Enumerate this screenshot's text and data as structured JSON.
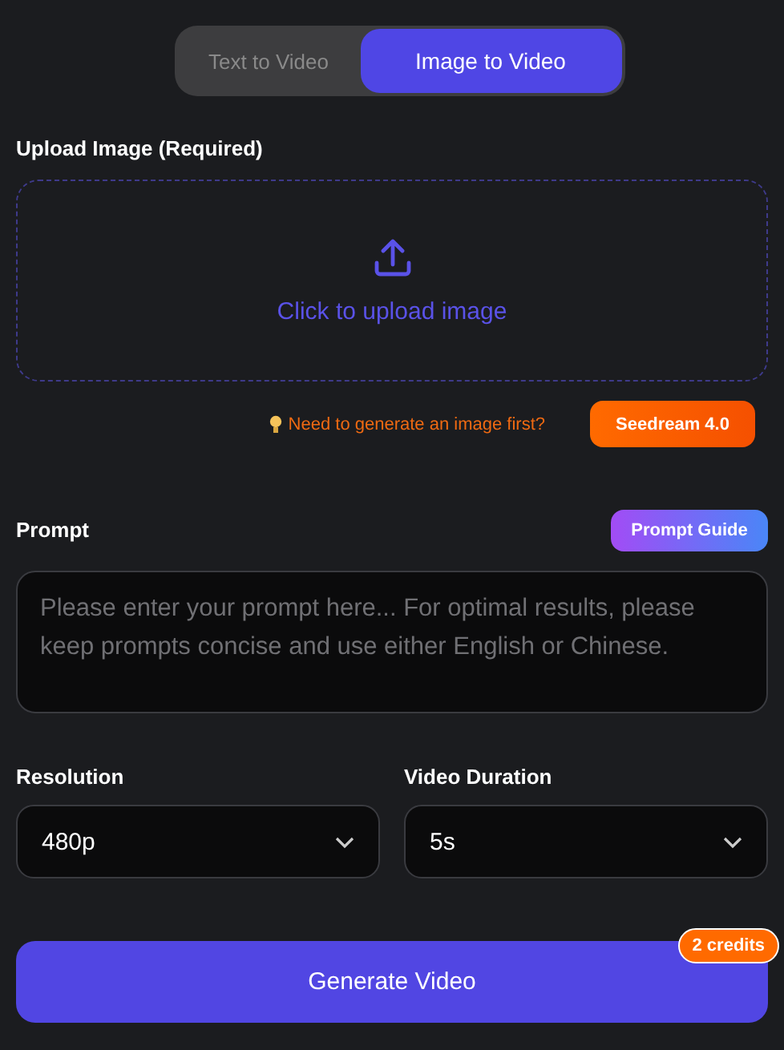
{
  "tabs": [
    {
      "label": "Text to Video",
      "selected": false
    },
    {
      "label": "Image to Video",
      "selected": true
    }
  ],
  "upload": {
    "label": "Upload Image (Required)",
    "prompt": "Click to upload image"
  },
  "hint": {
    "text": "Need to generate an image first?",
    "button": "Seedream 4.0"
  },
  "prompt": {
    "label": "Prompt",
    "guide_button": "Prompt Guide",
    "placeholder": "Please enter your prompt here... For optimal results, please keep prompts concise and use either English or Chinese."
  },
  "selects": [
    {
      "label": "Resolution",
      "value": "480p"
    },
    {
      "label": "Video Duration",
      "value": "5s"
    }
  ],
  "generate": {
    "label": "Generate Video",
    "badge": "2 credits"
  }
}
